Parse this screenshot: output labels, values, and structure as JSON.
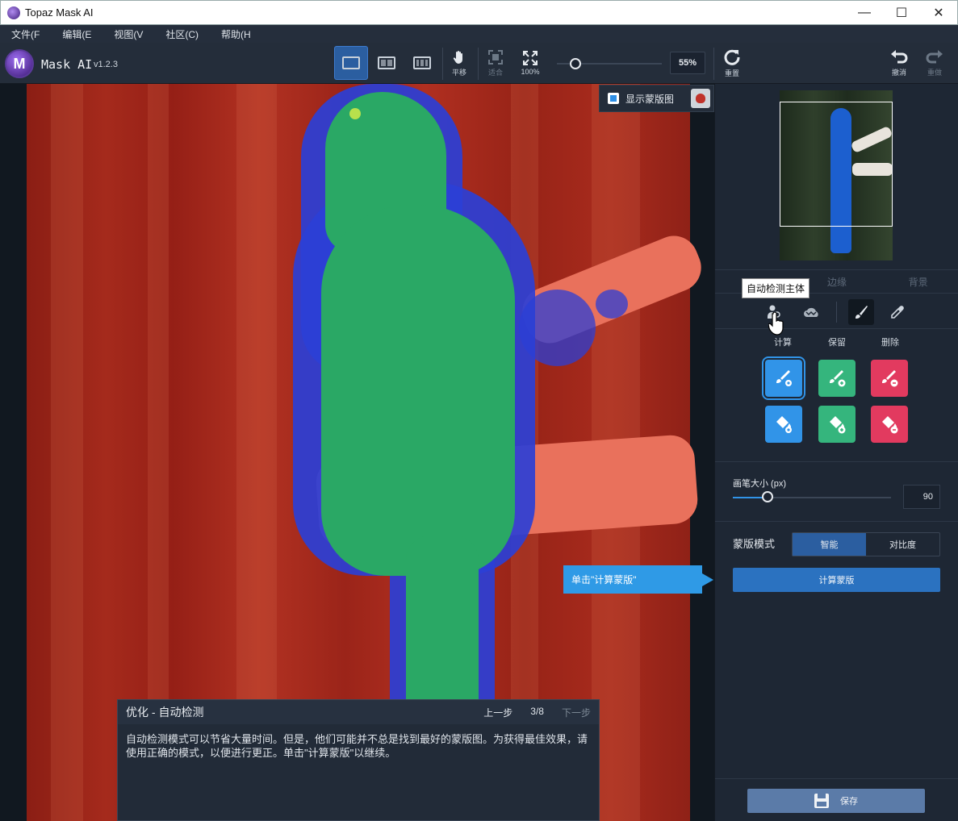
{
  "window": {
    "title": "Topaz Mask AI",
    "minimize": "—",
    "maximize": "☐",
    "close": "✕"
  },
  "menu": [
    "文件(F",
    "编辑(E",
    "视图(V",
    "社区(C)",
    "帮助(H"
  ],
  "app": {
    "logo": "M",
    "name": "Mask AI",
    "version": "v1.2.3"
  },
  "toolbar": {
    "pan_label": "平移",
    "fit_label": "适合",
    "full_label": "100%",
    "zoom_value": "55%",
    "reset_label": "重置",
    "undo_label": "撤消",
    "redo_label": "重做"
  },
  "show_mask": {
    "label": "显示蒙版图",
    "checked": true
  },
  "tutorial": {
    "title": "优化 - 自动检测",
    "prev": "上一步",
    "step": "3/8",
    "next": "下一步",
    "body": "自动检测模式可以节省大量时间。但是，他们可能并不总是找到最好的蒙版图。为获得最佳效果，请使用正确的模式，以便进行更正。单击\"计算蒙版\"以继续。"
  },
  "callout": "单击\"计算蒙版\"",
  "right": {
    "tabs": [
      "",
      "边缘",
      "背景"
    ],
    "tooltip": "自动检测主体",
    "tools": [
      "person-detect-icon",
      "cloud-icon",
      "brush-icon",
      "eyedropper-icon"
    ],
    "mode_labels": [
      "计算",
      "保留",
      "删除"
    ],
    "brush_label": "画笔大小 (px)",
    "brush_value": "90",
    "brush_fraction": 0.22,
    "mask_mode_label": "蒙版模式",
    "mask_mode_options": [
      "智能",
      "对比度"
    ],
    "mask_mode_selected": "智能",
    "compute_label": "计算蒙版",
    "save_label": "保存"
  },
  "colors": {
    "accent": "#2f9ae6",
    "compute": "#3194e8",
    "keep": "#35b57d",
    "remove": "#e23a5f",
    "mask_background": "#a52a1c",
    "mask_subject": "#2aa865",
    "mask_edge": "#2b3fd6"
  }
}
